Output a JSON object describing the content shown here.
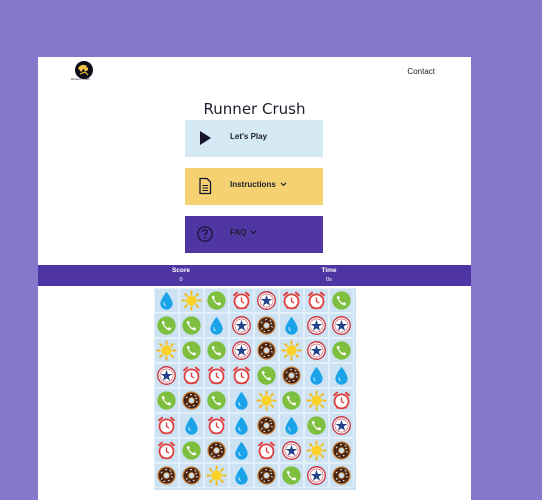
{
  "header": {
    "logo_text": "Runner Crush",
    "contact_label": "Contact"
  },
  "app": {
    "title": "Runner Crush"
  },
  "menu": {
    "play_label": "Let's Play",
    "instructions_label": "Instructions",
    "faq_label": "FAQ"
  },
  "stats": {
    "score_label": "Score",
    "score_value": "0",
    "time_label": "Time",
    "time_value": "0s"
  },
  "colors": {
    "background": "#8577cb",
    "play_bg": "#d5eaf5",
    "instructions_bg": "#f6d171",
    "faq_bg": "#5036a3",
    "scorebar_bg": "#4f34a3"
  },
  "board": [
    [
      "drop",
      "sun",
      "phone",
      "alarm",
      "star",
      "alarm",
      "alarm",
      "phone"
    ],
    [
      "phone",
      "phone",
      "drop",
      "star",
      "donut",
      "drop",
      "star",
      "star"
    ],
    [
      "sun",
      "phone",
      "phone",
      "star",
      "donut",
      "sun",
      "star",
      "phone"
    ],
    [
      "star",
      "alarm",
      "alarm",
      "alarm",
      "phone",
      "donut",
      "drop",
      "drop"
    ],
    [
      "phone",
      "donut",
      "phone",
      "drop",
      "sun",
      "phone",
      "sun",
      "alarm"
    ],
    [
      "alarm",
      "drop",
      "alarm",
      "drop",
      "donut",
      "drop",
      "phone",
      "star"
    ],
    [
      "alarm",
      "phone",
      "donut",
      "drop",
      "alarm",
      "star",
      "sun",
      "donut"
    ],
    [
      "donut",
      "donut",
      "sun",
      "drop",
      "donut",
      "phone",
      "star",
      "donut"
    ]
  ]
}
